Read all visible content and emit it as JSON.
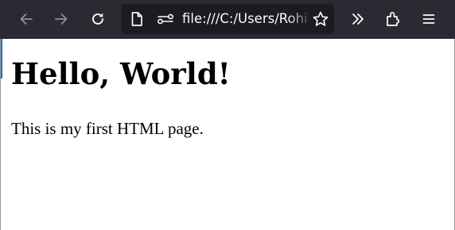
{
  "browser": {
    "toolbar": {
      "back_icon": "arrow-left-icon",
      "forward_icon": "arrow-right-icon",
      "reload_icon": "reload-icon",
      "overflow_icon": "chevron-double-right-icon",
      "extensions_icon": "puzzle-piece-icon",
      "menu_icon": "hamburger-menu-icon"
    },
    "urlbar": {
      "page_icon": "document-icon",
      "permissions_icon": "permissions-toggle-icon",
      "url": "file:///C:/Users/Rohit",
      "bookmark_icon": "star-outline-icon"
    }
  },
  "page": {
    "heading": "Hello, World!",
    "paragraph": "This is my first HTML page."
  },
  "colors": {
    "toolbar_bg": "#2b2a33",
    "urlbar_bg": "#1c1b22",
    "icon_active": "#fbfbfe",
    "icon_disabled": "#8f8f9d",
    "page_bg": "#ffffff",
    "accent": "#1a73c9"
  }
}
